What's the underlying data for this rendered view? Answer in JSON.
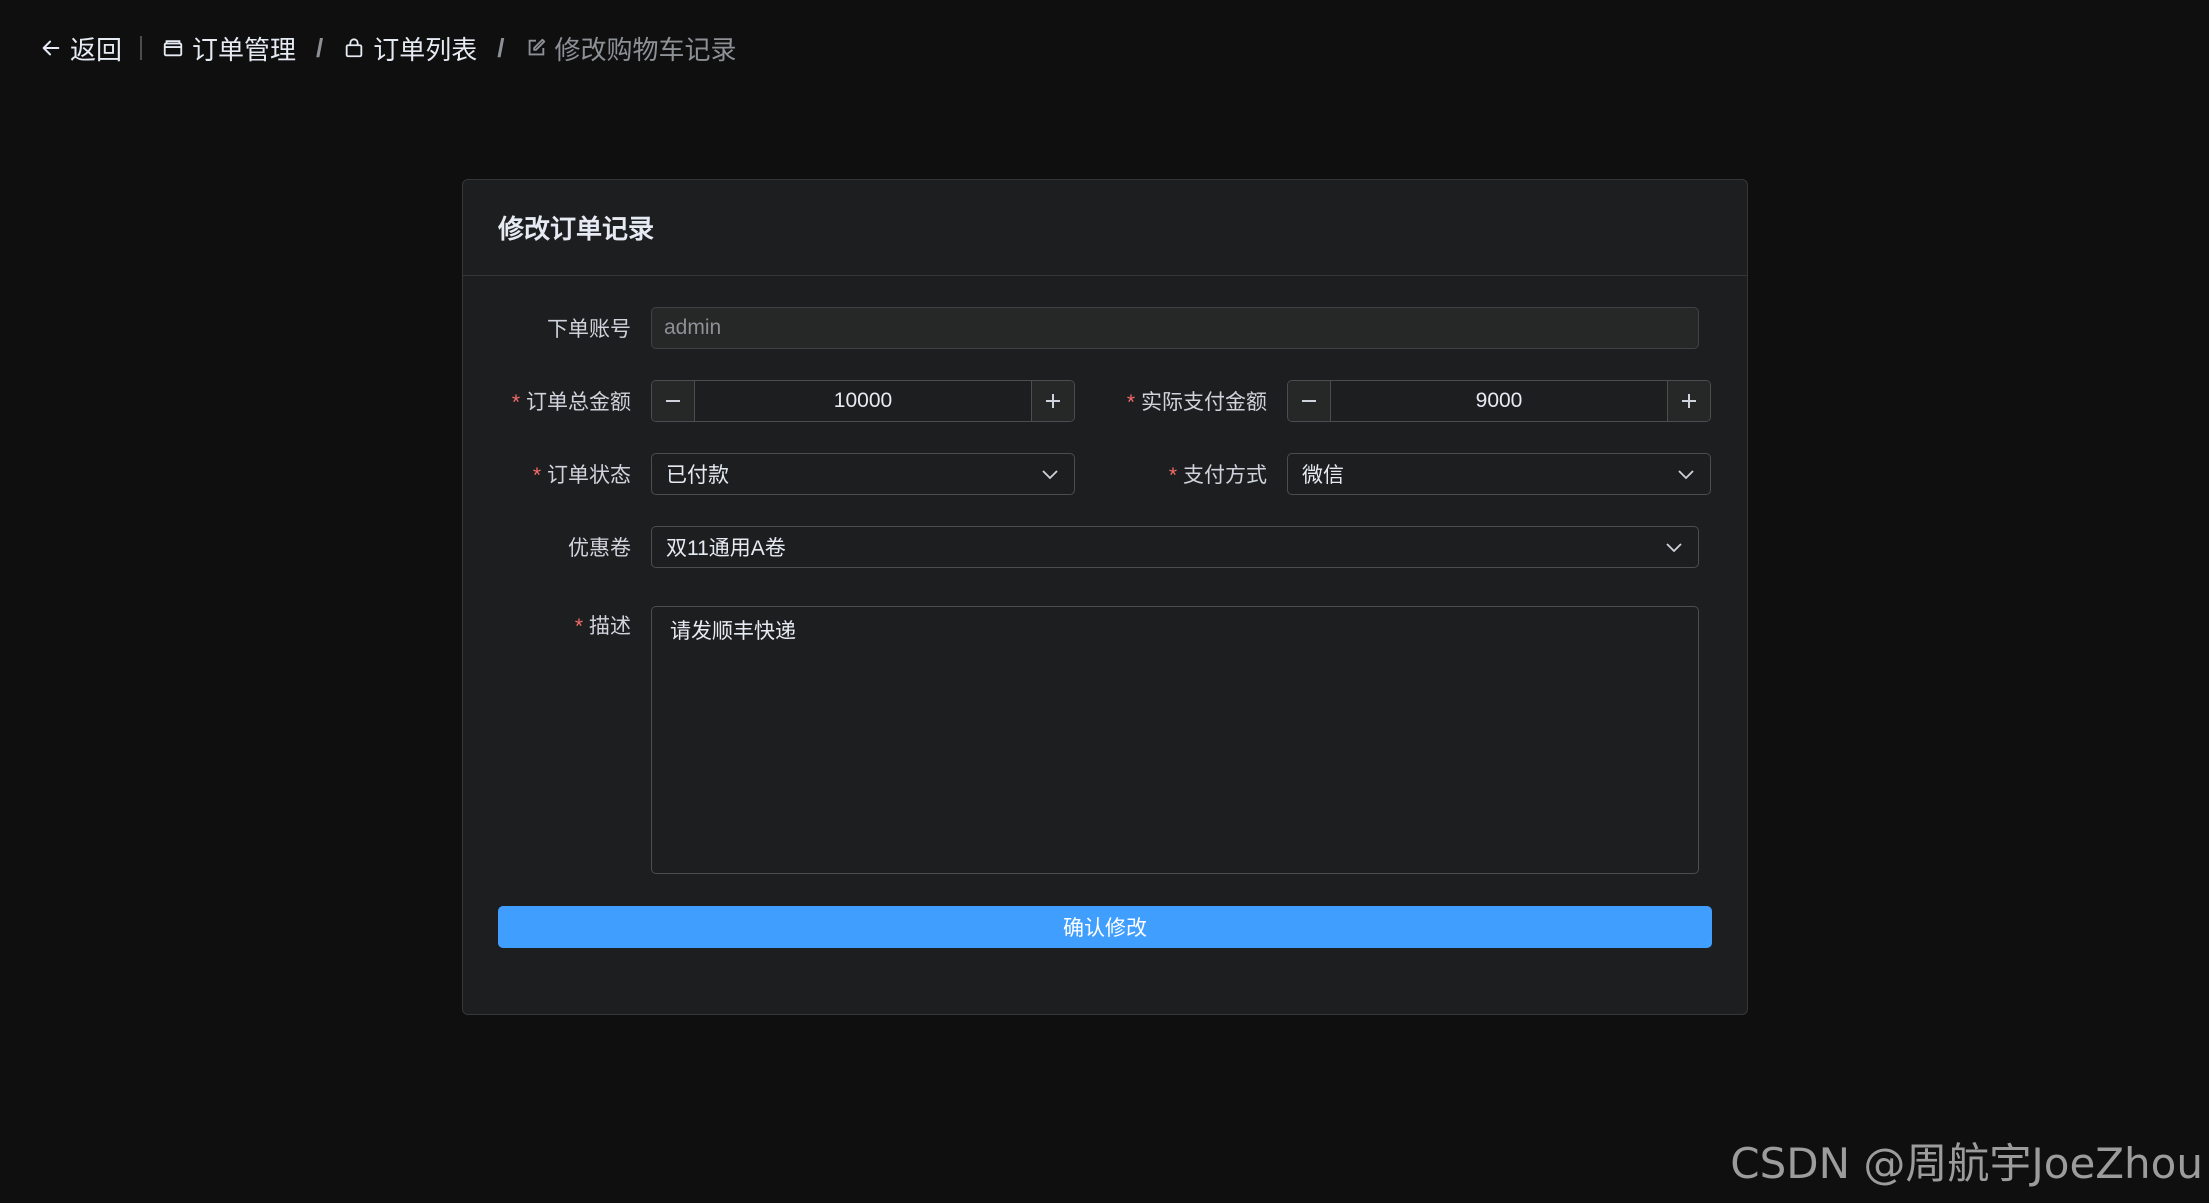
{
  "breadcrumb": {
    "back": "返回",
    "items": [
      {
        "label": "订单管理",
        "icon": "folder-icon"
      },
      {
        "label": "订单列表",
        "icon": "bag-icon"
      },
      {
        "label": "修改购物车记录",
        "icon": "edit-icon"
      }
    ],
    "separator": "/"
  },
  "card": {
    "title": "修改订单记录"
  },
  "form": {
    "account": {
      "label": "下单账号",
      "value": "admin"
    },
    "total_amount": {
      "label": "订单总金额",
      "value": "10000",
      "required": true
    },
    "paid_amount": {
      "label": "实际支付金额",
      "value": "9000",
      "required": true
    },
    "status": {
      "label": "订单状态",
      "value": "已付款",
      "required": true
    },
    "pay_method": {
      "label": "支付方式",
      "value": "微信",
      "required": true
    },
    "coupon": {
      "label": "优惠卷",
      "value": "双11通用A卷"
    },
    "description": {
      "label": "描述",
      "value": "请发顺丰快递",
      "required": true
    },
    "required_mark": "*",
    "submit_label": "确认修改"
  },
  "colors": {
    "accent": "#409eff",
    "required": "#f56c6c",
    "background": "#0f0f10",
    "card": "#1d1e1f"
  },
  "watermark": "CSDN @周航宇JoeZhou"
}
